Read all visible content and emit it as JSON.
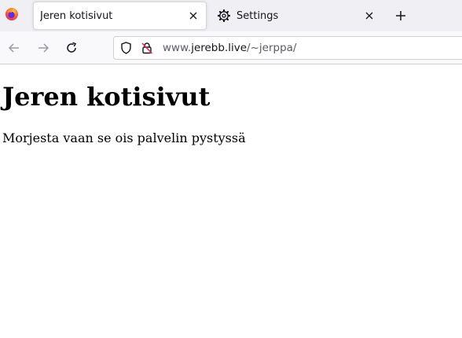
{
  "browser": {
    "tabs": [
      {
        "title": "Jeren kotisivut",
        "active": true
      },
      {
        "title": "Settings",
        "active": false,
        "icon": "gear-icon"
      }
    ],
    "address_bar": {
      "url_prefix": "www.",
      "url_host": "jerebb.live",
      "url_path": "/~jerppa/"
    }
  },
  "page": {
    "heading": "Jeren kotisivut",
    "paragraph": "Morjesta vaan se ois palvelin pystyssä"
  },
  "colors": {
    "tabbar_bg": "#f0f0f4",
    "toolbar_bg": "#f9f9fb",
    "text": "#15141a",
    "muted": "#5b5b66"
  }
}
